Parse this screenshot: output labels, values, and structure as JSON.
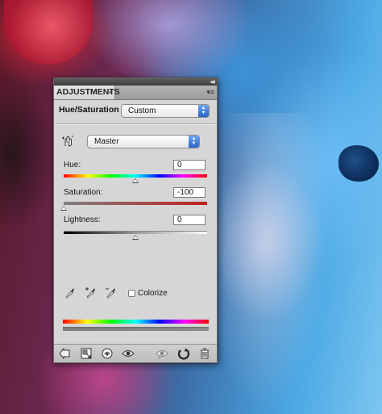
{
  "panel": {
    "tab_title": "ADJUSTMENTS",
    "tab_close": "×",
    "menu_glyph": "▾≡",
    "collapse_glyph": "◂◂",
    "adjustment_name": "Hue/Saturation",
    "preset_value": "Custom",
    "channel_value": "Master"
  },
  "sliders": {
    "hue": {
      "label": "Hue:",
      "value": "0",
      "level": 0.5
    },
    "saturation": {
      "label": "Saturation:",
      "value": "-100",
      "level": 0.0
    },
    "lightness": {
      "label": "Lightness:",
      "value": "0",
      "level": 0.5
    }
  },
  "colorize": {
    "label": "Colorize",
    "checked": false
  },
  "icons": {
    "header": [
      "on-image-adjustment-tool-icon"
    ],
    "eyedroppers": [
      "eyedropper-icon",
      "eyedropper-plus-icon",
      "eyedropper-minus-icon"
    ],
    "bottom_toolbar": [
      "return-arrow-icon",
      "clip-to-layer-icon",
      "visibility-toggle-icon",
      "view-previous-state-icon",
      "reset-icon",
      "delete-icon"
    ]
  },
  "colors": {
    "select_arrow_blue": "#2b63c8",
    "panel_bg": "#d6d6d6",
    "titlebar": "#4a4a4a"
  }
}
